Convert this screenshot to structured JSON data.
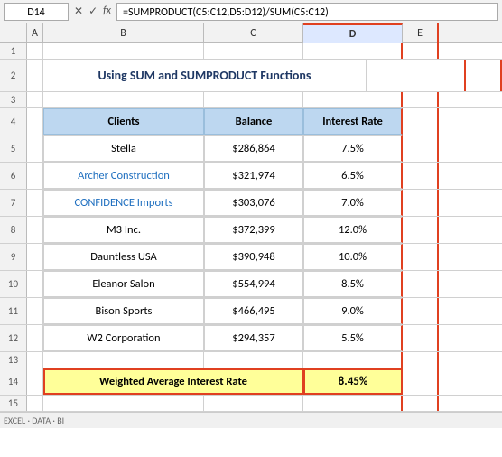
{
  "namebox": {
    "value": "D14"
  },
  "formula": {
    "value": "=SUMPRODUCT(C5:C12,D5:D12)/SUM(C5:C12)"
  },
  "columns": [
    "A",
    "B",
    "C",
    "D",
    "E"
  ],
  "title": "Using SUM and SUMPRODUCT Functions",
  "headers": {
    "clients": "Clients",
    "balance": "Balance",
    "interest_rate": "Interest Rate"
  },
  "rows": [
    {
      "num": "1",
      "b": "",
      "c": "",
      "d": "",
      "short": true
    },
    {
      "num": "2",
      "b": "",
      "c": "",
      "d": "",
      "title_row": true
    },
    {
      "num": "3",
      "b": "",
      "c": "",
      "d": "",
      "short": true
    },
    {
      "num": "4",
      "b": "Clients",
      "c": "Balance",
      "d": "Interest Rate",
      "header": true
    },
    {
      "num": "5",
      "b": "Stella",
      "c": "$286,864",
      "d": "7.5%",
      "b_blue": false
    },
    {
      "num": "6",
      "b": "Archer Construction",
      "c": "$321,974",
      "d": "6.5%",
      "b_blue": true
    },
    {
      "num": "7",
      "b": "CONFIDENCE Imports",
      "c": "$303,076",
      "d": "7.0%",
      "b_blue": true
    },
    {
      "num": "8",
      "b": "M3 Inc.",
      "c": "$372,399",
      "d": "12.0%",
      "b_blue": false
    },
    {
      "num": "9",
      "b": "Dauntless USA",
      "c": "$390,948",
      "d": "10.0%",
      "b_blue": false
    },
    {
      "num": "10",
      "b": "Eleanor Salon",
      "c": "$554,994",
      "d": "8.5%",
      "b_blue": false
    },
    {
      "num": "11",
      "b": "Bison Sports",
      "c": "$466,495",
      "d": "9.0%",
      "b_blue": false
    },
    {
      "num": "12",
      "b": "W2 Corporation",
      "c": "$294,357",
      "d": "5.5%",
      "b_blue": false
    },
    {
      "num": "13",
      "b": "",
      "c": "",
      "d": "",
      "short": true
    },
    {
      "num": "14",
      "b": "Weighted Average Interest Rate",
      "c": "",
      "d": "8.45%",
      "result": true
    },
    {
      "num": "15",
      "b": "",
      "c": "",
      "d": "",
      "short": true
    }
  ],
  "bottom": "EXCEL · DATA · BI"
}
